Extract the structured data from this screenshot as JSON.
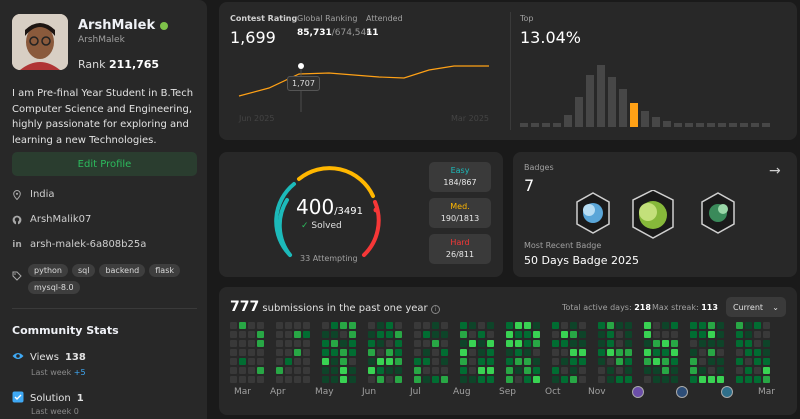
{
  "profile": {
    "name": "ArshMalek",
    "handle": "ArshMalek",
    "rank_label": "Rank",
    "rank_value": "211,765",
    "bio": "I am Pre-final Year Student in B.Tech Computer Science and Engineering, highly passionate for exploring and learning a new Technologies.",
    "edit_label": "Edit Profile",
    "location": "India",
    "github": "ArshMalik07",
    "linkedin": "arsh-malek-6a808b25a",
    "tags": [
      "python",
      "sql",
      "backend",
      "flask",
      "mysql-8.0"
    ]
  },
  "community": {
    "title": "Community Stats",
    "views_label": "Views",
    "views_value": "138",
    "views_sub": "Last week",
    "views_delta": "+5",
    "solution_label": "Solution",
    "solution_value": "1",
    "solution_sub": "Last week",
    "solution_delta": "0"
  },
  "contest": {
    "rating_label": "Contest Rating",
    "rating_value": "1,699",
    "global_label": "Global Ranking",
    "global_value": "85,731",
    "global_total": "/674,546",
    "attended_label": "Attended",
    "attended_value": "11",
    "tooltip": "1,707",
    "axis_start": "Jun 2025",
    "axis_end": "Mar 2025",
    "top_label": "Top",
    "top_value": "13.04%",
    "accent": "#ffa116"
  },
  "solved": {
    "count": "400",
    "total": "/3491",
    "solved_label": "Solved",
    "attempting": "33 Attempting",
    "easy_label": "Easy",
    "easy_value": "184/867",
    "medium_label": "Med.",
    "medium_value": "190/1813",
    "hard_label": "Hard",
    "hard_value": "26/811",
    "easy_color": "#1cbaba",
    "medium_color": "#ffb700",
    "hard_color": "#f63737"
  },
  "badges": {
    "title": "Badges",
    "count": "7",
    "recent_label": "Most Recent Badge",
    "recent_name": "50 Days Badge 2025"
  },
  "submissions": {
    "count": "777",
    "label": "submissions in the past one year",
    "active_label": "Total active days:",
    "active_value": "218",
    "streak_label": "Max streak:",
    "streak_value": "113",
    "select_value": "Current",
    "months": [
      "Mar",
      "Apr",
      "May",
      "Jun",
      "Jul",
      "Aug",
      "Sep",
      "Oct",
      "Nov",
      "",
      "",
      "",
      "Mar"
    ]
  }
}
